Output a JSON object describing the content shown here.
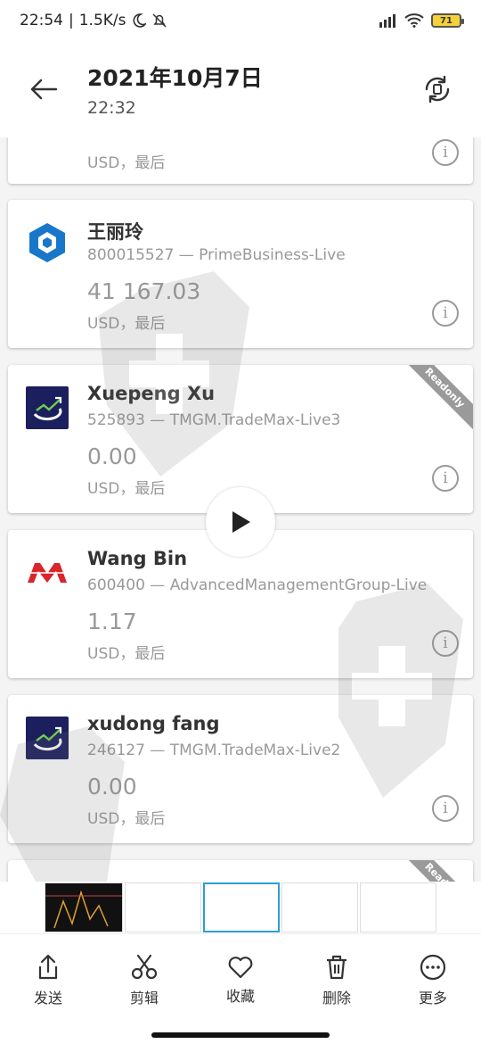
{
  "status_bar": {
    "time": "22:54",
    "speed": "1.5K/s",
    "battery": "71"
  },
  "header": {
    "title": "2021年10月7日",
    "subtitle": "22:32"
  },
  "accounts": [
    {
      "name": "",
      "account": "",
      "balance": "",
      "currency": "USD，最后",
      "readonly": false
    },
    {
      "name": "王丽玲",
      "account": "800015527 — PrimeBusiness-Live",
      "balance": "41 167.03",
      "currency": "USD，最后",
      "readonly": false
    },
    {
      "name": "Xuepeng Xu",
      "account": "525893 — TMGM.TradeMax-Live3",
      "balance": "0.00",
      "currency": "USD，最后",
      "readonly": true
    },
    {
      "name": "Wang Bin",
      "account": "600400 — AdvancedManagementGroup-Live",
      "balance": "1.17",
      "currency": "USD，最后",
      "readonly": false
    },
    {
      "name": "xudong fang",
      "account": "246127 — TMGM.TradeMax-Live2",
      "balance": "0.00",
      "currency": "USD，最后",
      "readonly": false
    },
    {
      "name": "",
      "account": "",
      "balance": "",
      "currency": "",
      "readonly": true
    }
  ],
  "ribbon_label": "Readonly",
  "toolbar": [
    {
      "label": "发送",
      "icon": "share-icon"
    },
    {
      "label": "剪辑",
      "icon": "scissors-icon"
    },
    {
      "label": "收藏",
      "icon": "heart-icon"
    },
    {
      "label": "删除",
      "icon": "trash-icon"
    },
    {
      "label": "更多",
      "icon": "more-icon"
    }
  ],
  "colors": {
    "tmgm_navy": "#1b1f5e",
    "prime_blue": "#1877c9",
    "amg_red": "#d7262c"
  }
}
